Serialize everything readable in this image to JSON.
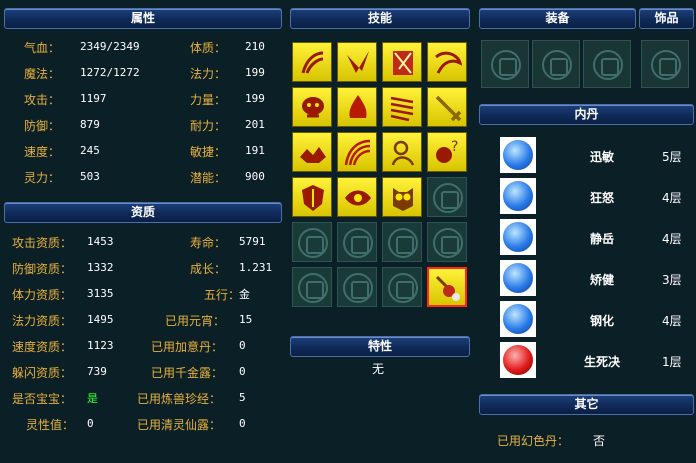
{
  "headers": {
    "attributes": "属性",
    "skills": "技能",
    "equipment": "装备",
    "accessory": "饰品",
    "inner_core": "内丹",
    "aptitude": "资质",
    "traits": "特性",
    "other": "其它"
  },
  "attributes": [
    {
      "label": "气血：",
      "value": "2349/2349",
      "label2": "体质：",
      "value2": "210"
    },
    {
      "label": "魔法：",
      "value": "1272/1272",
      "label2": "法力：",
      "value2": "199"
    },
    {
      "label": "攻击：",
      "value": "1197",
      "label2": "力量：",
      "value2": "199"
    },
    {
      "label": "防御：",
      "value": "879",
      "label2": "耐力：",
      "value2": "201"
    },
    {
      "label": "速度：",
      "value": "245",
      "label2": "敏捷：",
      "value2": "191"
    },
    {
      "label": "灵力：",
      "value": "503",
      "label2": "潜能：",
      "value2": "900"
    }
  ],
  "aptitude": [
    {
      "label": "攻击资质：",
      "value": "1453",
      "label2": "寿命：",
      "value2": "5791"
    },
    {
      "label": "防御资质：",
      "value": "1332",
      "label2": "成长：",
      "value2": "1.231"
    },
    {
      "label": "体力资质：",
      "value": "3135",
      "label2": "五行：",
      "value2": "金"
    },
    {
      "label": "法力资质：",
      "value": "1495",
      "label2": "已用元宵：",
      "value2": "15"
    },
    {
      "label": "速度资质：",
      "value": "1123",
      "label2": "已用加意丹：",
      "value2": "0"
    },
    {
      "label": "躲闪资质：",
      "value": "739",
      "label2": "已用千金露：",
      "value2": "0"
    },
    {
      "label": "是否宝宝：",
      "value": "是",
      "label2": "已用炼兽珍经：",
      "value2": "5"
    },
    {
      "label": "灵性值：",
      "value": "0",
      "label2": "已用清灵仙露：",
      "value2": "0"
    }
  ],
  "traits_value": "无",
  "inner_cores": [
    {
      "name": "迅敏",
      "level": "5层",
      "icon": "claw-icon",
      "color": "blue"
    },
    {
      "name": "狂怒",
      "level": "4层",
      "icon": "sword-icon",
      "color": "blue"
    },
    {
      "name": "静岳",
      "level": "4层",
      "icon": "mountain-icon",
      "color": "blue"
    },
    {
      "name": "矫健",
      "level": "3层",
      "icon": "drop-icon",
      "color": "blue"
    },
    {
      "name": "钢化",
      "level": "4层",
      "icon": "shield-icon",
      "color": "blue"
    },
    {
      "name": "生死决",
      "level": "1层",
      "icon": "swirl-icon",
      "color": "red"
    }
  ],
  "other": {
    "label": "已用幻色丹：",
    "value": "否"
  },
  "skills_icons": [
    "wind-slash-icon",
    "claw-strike-icon",
    "armor-break-icon",
    "dash-icon",
    "serpent-icon",
    "flame-icon",
    "scroll-icon",
    "sword-icon",
    "beast-icon",
    "arc-icon",
    "spirit-icon",
    "question-orb-icon",
    "shield-icon",
    "eye-icon",
    "owl-icon"
  ],
  "colors": {
    "label": "#e8b23a",
    "skill_bg": "#fff23a",
    "panel_bg": "#0b1f27",
    "selected_border": "#ff2a1a"
  }
}
